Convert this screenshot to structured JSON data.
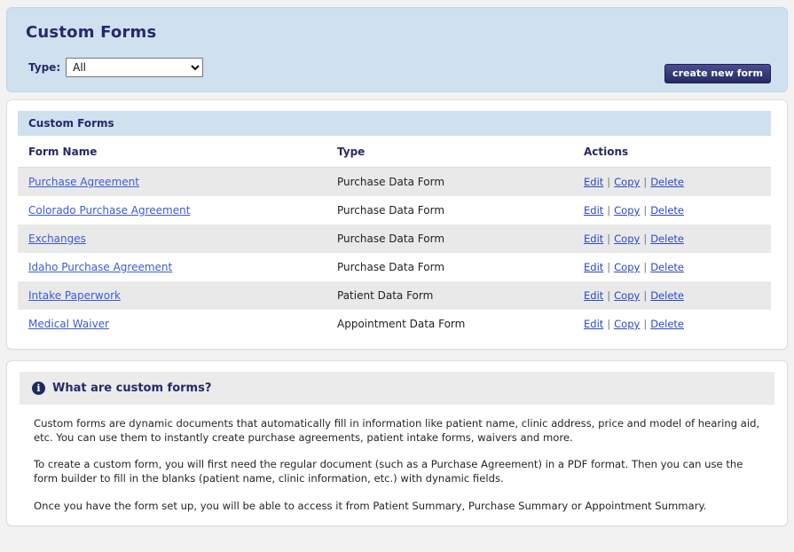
{
  "header": {
    "title": "Custom Forms",
    "type_label": "Type:",
    "type_selected": "All",
    "type_options": [
      "All",
      "Purchase Data Form",
      "Patient Data Form",
      "Appointment Data Form"
    ],
    "create_button": "create new form",
    "accent_color": "#27286b",
    "panel_color": "#cfe0ef",
    "button_color": "#3a3d7c"
  },
  "table": {
    "section_title": "Custom Forms",
    "columns": [
      "Form Name",
      "Type",
      "Actions"
    ],
    "actions": {
      "edit": "Edit",
      "copy": "Copy",
      "delete": "Delete",
      "separator": "|"
    },
    "rows": [
      {
        "name": "Purchase Agreement",
        "type": "Purchase Data Form"
      },
      {
        "name": "Colorado Purchase Agreement",
        "type": "Purchase Data Form"
      },
      {
        "name": "Exchanges",
        "type": "Purchase Data Form"
      },
      {
        "name": "Idaho Purchase Agreement",
        "type": "Purchase Data Form"
      },
      {
        "name": "Intake Paperwork",
        "type": "Patient Data Form"
      },
      {
        "name": "Medical Waiver",
        "type": "Appointment Data Form"
      }
    ],
    "link_color": "#3b5bdb",
    "stripe_color": "#e9e9e9"
  },
  "info": {
    "icon": "info-icon",
    "icon_glyph": "i",
    "title": "What are custom forms?",
    "paragraphs": [
      "Custom forms are dynamic documents that automatically fill in information like patient name, clinic address, price and model of hearing aid, etc. You can use them to instantly create purchase agreements, patient intake forms, waivers and more.",
      "To create a custom form, you will first need the regular document (such as a Purchase Agreement) in a PDF format. Then you can use the form builder to fill in the blanks (patient name, clinic information, etc.) with dynamic fields.",
      "Once you have the form set up, you will be able to access it from Patient Summary, Purchase Summary or Appointment Summary."
    ]
  }
}
